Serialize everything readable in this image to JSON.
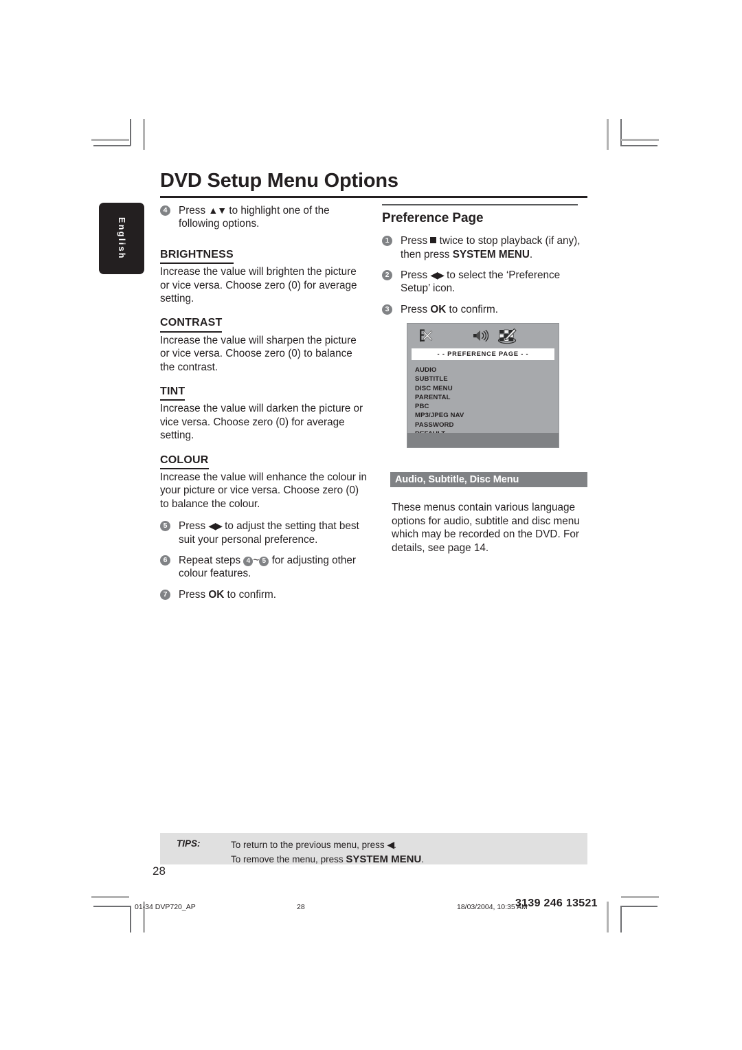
{
  "page": {
    "title": "DVD Setup Menu Options",
    "language_tab": "English",
    "page_number": "28"
  },
  "left_column": {
    "steps": [
      {
        "num": "4",
        "text_before": "Press ",
        "arrows": "▲▼",
        "text_after": " to highlight one of the following options."
      }
    ],
    "sections": [
      {
        "heading": "BRIGHTNESS",
        "body": "Increase the value will brighten the picture or vice versa. Choose zero (0) for average setting."
      },
      {
        "heading": "CONTRAST",
        "body": "Increase the value will sharpen the picture or vice versa.  Choose zero (0) to balance the contrast."
      },
      {
        "heading": "TINT",
        "body": "Increase the value will darken the picture or vice versa.  Choose zero (0) for average setting."
      },
      {
        "heading": "COLOUR",
        "body": "Increase the value will enhance the colour in your picture or vice versa. Choose zero (0) to balance the colour."
      }
    ],
    "step5": {
      "num": "5",
      "text_before": "Press ",
      "arrows": "◀▶",
      "text_after": "  to adjust the setting that best suit your personal preference."
    },
    "step6": {
      "num": "6",
      "text_before": "Repeat steps ",
      "ref_a": "4",
      "tilde": "~",
      "ref_b": "5",
      "text_after": " for adjusting other colour features."
    },
    "step7": {
      "num": "7",
      "text_before": "Press ",
      "bold": "OK",
      "text_after": " to confirm."
    }
  },
  "right_column": {
    "heading": "Preference Page",
    "step1": {
      "num": "1",
      "text_before": "Press ",
      "icon": "stop-square-icon",
      "text_mid": " twice to stop playback (if any), then press ",
      "bold": "SYSTEM MENU",
      "text_after": "."
    },
    "step2": {
      "num": "2",
      "text_before": "Press ",
      "arrows": "◀▶",
      "text_after": " to select the ‘Preference Setup’ icon."
    },
    "step3": {
      "num": "3",
      "text_before": "Press ",
      "bold": "OK",
      "text_after": " to confirm."
    },
    "section": {
      "heading": "Audio, Subtitle, Disc Menu",
      "body": "These menus contain various language options for audio, subtitle and disc menu which may be recorded on the DVD.  For details, see page 14."
    }
  },
  "osd": {
    "icons": [
      {
        "name": "video-setup-icon",
        "label": "Video Setup"
      },
      {
        "name": "audio-setup-icon",
        "label": "Audio Setup"
      },
      {
        "name": "preference-setup-icon",
        "label": "Preference Setup"
      }
    ],
    "title": "- -  PREFERENCE  PAGE  - -",
    "items": [
      "AUDIO",
      "SUBTITLE",
      "DISC MENU",
      "PARENTAL",
      "PBC",
      "MP3/JPEG NAV",
      "PASSWORD",
      "DEFAULT"
    ],
    "colors": {
      "background": "#a7a9ac",
      "footer": "#808285",
      "titlebar": "#ffffff"
    }
  },
  "tips": {
    "label": "TIPS:",
    "line1_before": "To return to the previous menu, press ",
    "line1_arrow": "◀",
    "line1_after": ".",
    "line2_before": "To remove the menu, press ",
    "line2_bold": "SYSTEM MENU",
    "line2_after": "."
  },
  "print_footer": {
    "file": "01-34 DVP720_AP",
    "page": "28",
    "date": "18/03/2004, 10:35 AM",
    "code": "3139 246 13521"
  },
  "colors": {
    "ink": "#231f20",
    "grey_bar": "#808285",
    "osd_grey": "#a7a9ac",
    "tips_grey": "#e0e0e0"
  }
}
